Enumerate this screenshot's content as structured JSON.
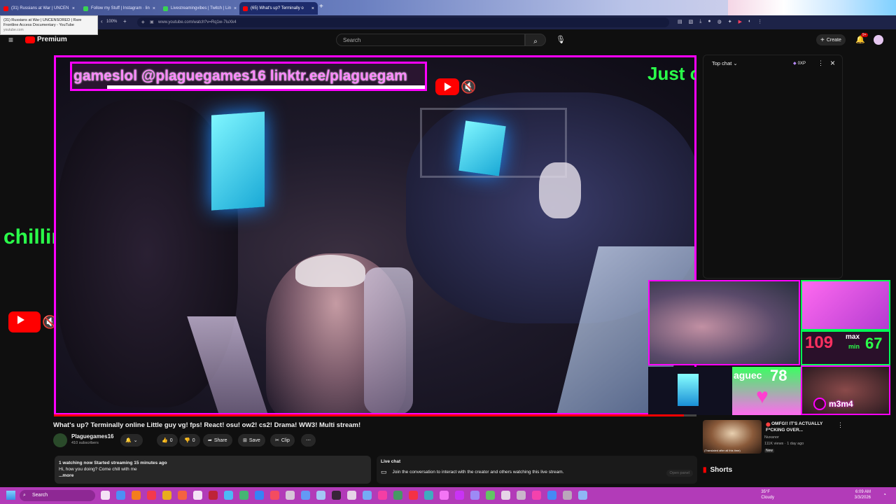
{
  "browser": {
    "tabs": [
      {
        "label": "(31) Russians at War | UNCEN",
        "favicon_color": "#ff0000",
        "active": false
      },
      {
        "label": "Follow my Stuff | Instagram · lin",
        "favicon_color": "#39d353",
        "active": false
      },
      {
        "label": "Livestreamingvibes | Twitch | Lin",
        "favicon_color": "#39d353",
        "active": false
      },
      {
        "label": "(65) What's up? Terminally o",
        "favicon_color": "#ff0000",
        "active": true
      }
    ],
    "new_tab": "+",
    "tooltip": {
      "line1": "(31) Russians at War | UNCENSORED | Rare",
      "line2": "Frontline Access Documentary - YouTube",
      "line3": "youtube.com"
    },
    "zoom": "100%",
    "url": "www.youtube.com/watch?v=Rq1w-7luXk4"
  },
  "youtube": {
    "logo_text": "Premium",
    "search_placeholder": "Search",
    "create_label": "Create",
    "notif_badge": "9+"
  },
  "video": {
    "banner_text": "gameslol  @plaguegames16  linktr.ee/plaguegam",
    "overlay_right_text": "Just c",
    "overlay_left_text": "chilling",
    "cam_stats": {
      "max_label": "max",
      "min_label": "min",
      "big_number": "109",
      "min_value": "67",
      "score": "78",
      "tag_text": "aguec",
      "user": "m3m4"
    },
    "progress_fraction": 0.98
  },
  "chat": {
    "header": "Top chat",
    "points": "0XP"
  },
  "below": {
    "title": "What's up? Terminally online Little guy vg! fps! React! osu! ow2! cs2! Drama! WW3! Multi stream!",
    "channel": "Plaguegames16",
    "subscribers": "410 subscribers",
    "likes": "0",
    "dislikes": "0",
    "share": "Share",
    "save": "Save",
    "clip": "Clip",
    "watching": "1 watching now  Started streaming 15 minutes ago",
    "desc_line": "Hi, how you doing? Come chill with me",
    "more": "...more",
    "livechat_title": "Live chat",
    "livechat_msg": "Join the conversation to interact with the creator and others watching this live stream.",
    "open_panel": "Open panel"
  },
  "recommended": {
    "title_line1": "OMFG!! IT'S ACTUALLY",
    "title_line2": "F*CKING OVER...",
    "channel": "Nuxanor",
    "meta": "111K views · 1 day ago",
    "badge": "New",
    "thumb_caption": "(Translated after all this time)"
  },
  "shorts_label": "Shorts",
  "taskbar": {
    "search_label": "Search",
    "weather_temp": "35°F",
    "weather_desc": "Cloudy",
    "time": "6:09 AM",
    "date": "3/3/2026"
  }
}
